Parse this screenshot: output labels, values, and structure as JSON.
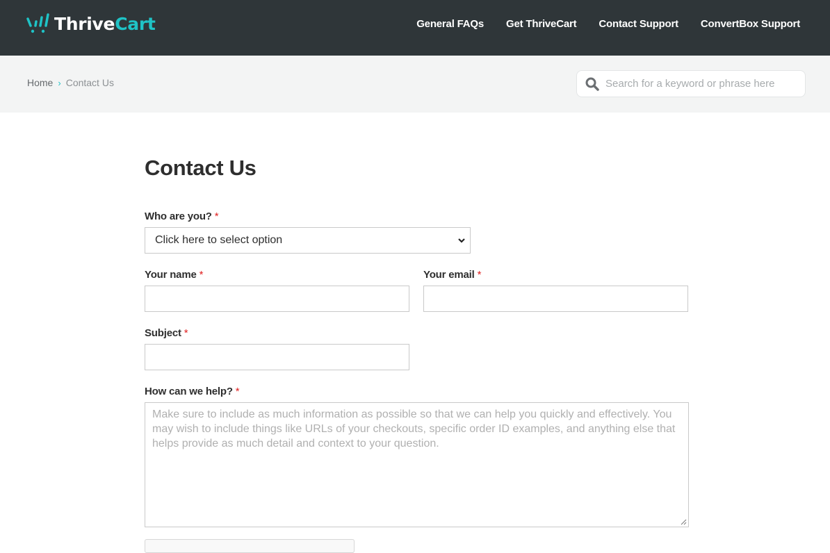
{
  "brand": {
    "name_part1": "Thrive",
    "name_part2": "Cart",
    "accent_color": "#1fc3c6",
    "header_bg": "#2f3639"
  },
  "nav": {
    "items": [
      {
        "label": "General FAQs"
      },
      {
        "label": "Get ThriveCart"
      },
      {
        "label": "Contact Support"
      },
      {
        "label": "ConvertBox Support"
      }
    ]
  },
  "breadcrumb": {
    "home": "Home",
    "separator": "›",
    "current": "Contact Us"
  },
  "search": {
    "icon": "search-icon",
    "placeholder": "Search for a keyword or phrase here",
    "value": ""
  },
  "page": {
    "title": "Contact Us"
  },
  "form": {
    "required_mark": "*",
    "who": {
      "label": "Who are you?",
      "selected": "Click here to select option"
    },
    "name": {
      "label": "Your name",
      "value": ""
    },
    "email": {
      "label": "Your email",
      "value": ""
    },
    "subject": {
      "label": "Subject",
      "value": ""
    },
    "help": {
      "label": "How can we help?",
      "placeholder": "Make sure to include as much information as possible so that we can help you quickly and effectively. You may wish to include things like URLs of your checkouts, specific order ID examples, and anything else that helps provide as much detail and context to your question.",
      "value": ""
    }
  }
}
